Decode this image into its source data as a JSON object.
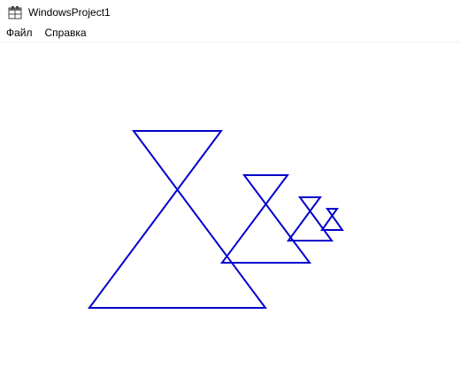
{
  "window": {
    "title": "WindowsProject1",
    "icon": "application-icon"
  },
  "menu": {
    "items": [
      {
        "label": "Файл"
      },
      {
        "label": "Справка"
      }
    ]
  },
  "canvas": {
    "stroke_color": "#0000cc",
    "shape": "hourglass",
    "hourglass_count": 4
  }
}
